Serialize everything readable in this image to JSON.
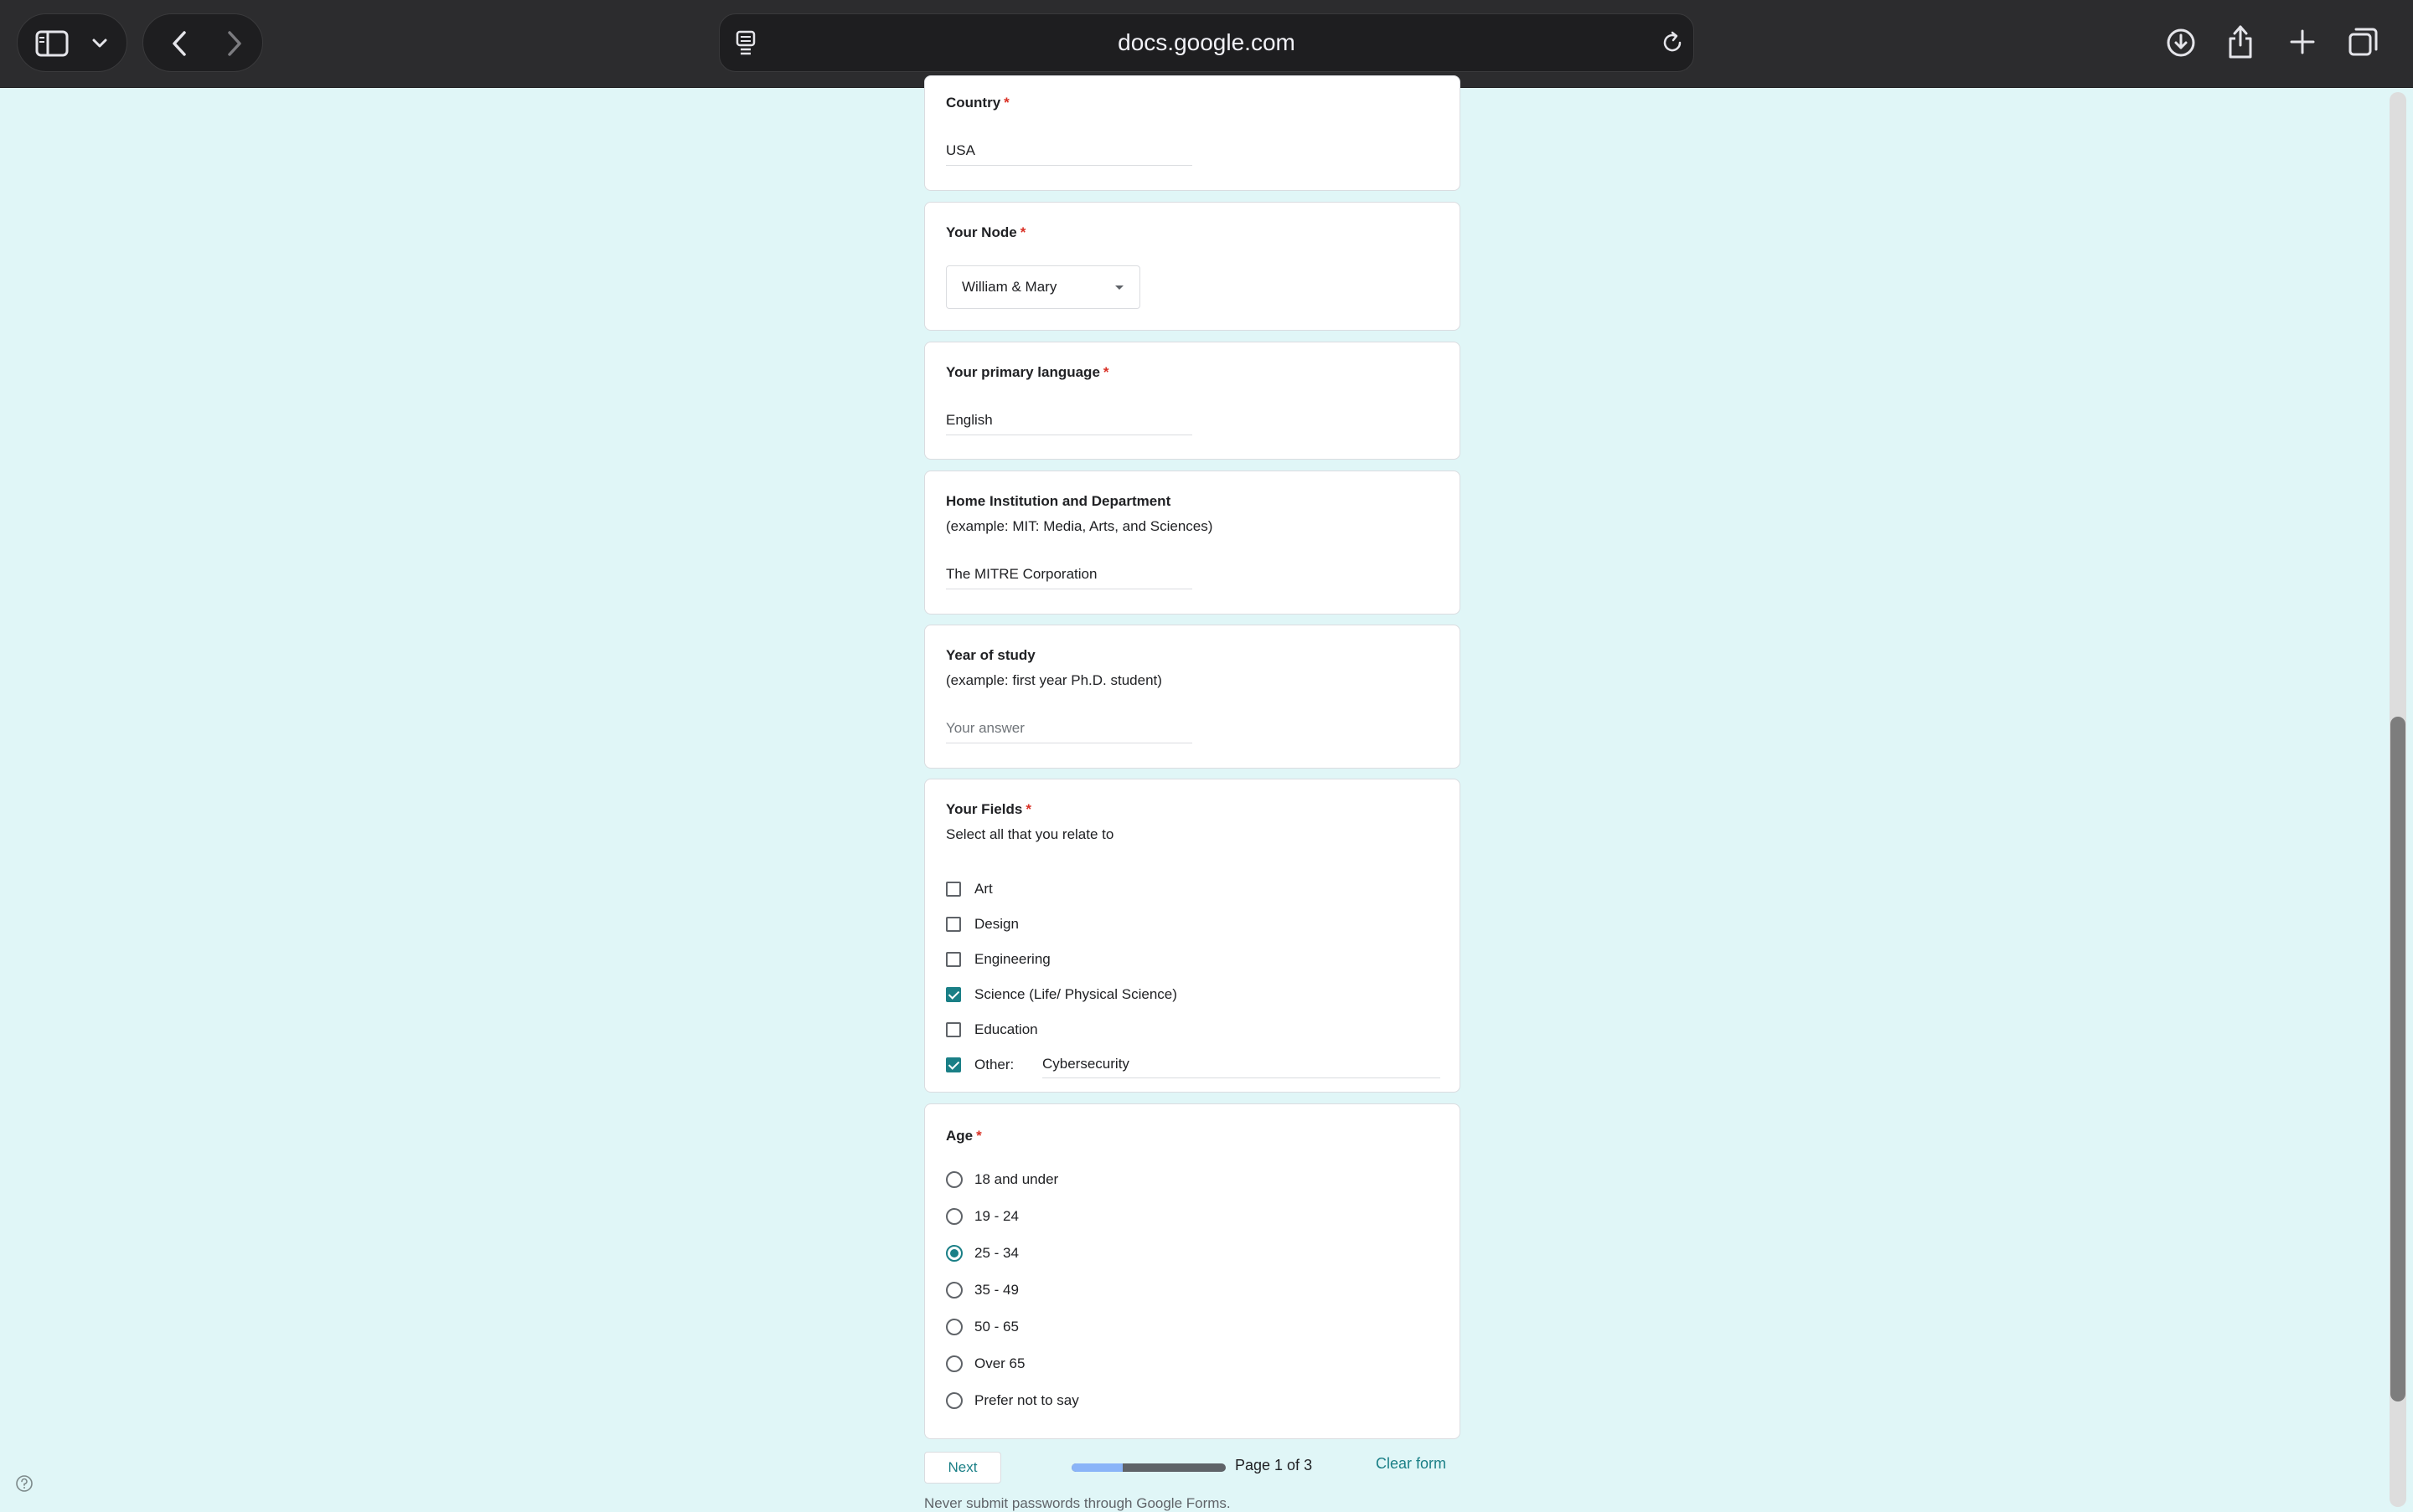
{
  "browser": {
    "url": "docs.google.com",
    "icons": [
      "sidebar-icon",
      "chevron-down-icon",
      "back-icon",
      "forward-icon",
      "page-icon",
      "reload-icon",
      "download-icon",
      "share-icon",
      "new-tab-icon",
      "tabs-overview-icon"
    ]
  },
  "form": {
    "country": {
      "title": "Country",
      "required_mark": "*",
      "value": "USA"
    },
    "node": {
      "title": "Your Node",
      "required_mark": "*",
      "selected": "William & Mary"
    },
    "language": {
      "title": "Your primary language",
      "required_mark": "*",
      "value": "English"
    },
    "institution": {
      "title": "Home Institution and Department",
      "description": "(example: MIT: Media, Arts, and Sciences)",
      "value": "The MITRE Corporation"
    },
    "year": {
      "title": "Year of study",
      "description": "(example: first year Ph.D. student)",
      "placeholder": "Your answer"
    },
    "fields": {
      "title": "Your Fields",
      "required_mark": "*",
      "description": "Select all that you relate to",
      "options": [
        {
          "label": "Art",
          "checked": false
        },
        {
          "label": "Design",
          "checked": false
        },
        {
          "label": "Engineering",
          "checked": false
        },
        {
          "label": "Science (Life/ Physical Science)",
          "checked": true
        },
        {
          "label": "Education",
          "checked": false
        },
        {
          "label": "Other:",
          "checked": true,
          "other_value": "Cybersecurity"
        }
      ]
    },
    "age": {
      "title": "Age",
      "required_mark": "*",
      "options": [
        {
          "label": "18 and under",
          "checked": false
        },
        {
          "label": "19 - 24",
          "checked": false
        },
        {
          "label": "25 - 34",
          "checked": true
        },
        {
          "label": "35 - 49",
          "checked": false
        },
        {
          "label": "50 - 65",
          "checked": false
        },
        {
          "label": "Over 65",
          "checked": false
        },
        {
          "label": "Prefer not to say",
          "checked": false
        }
      ]
    }
  },
  "footer": {
    "next_label": "Next",
    "progress_fraction": 0.333,
    "page_text": "Page 1 of 3",
    "clear_label": "Clear form",
    "note": "Never submit passwords through Google Forms."
  },
  "colors": {
    "page_background": "#e0f6f7",
    "accent": "#1a7f86",
    "required": "#d93025",
    "toolbar": "#2c2c2e",
    "progress_fill": "#8ab4f8"
  }
}
